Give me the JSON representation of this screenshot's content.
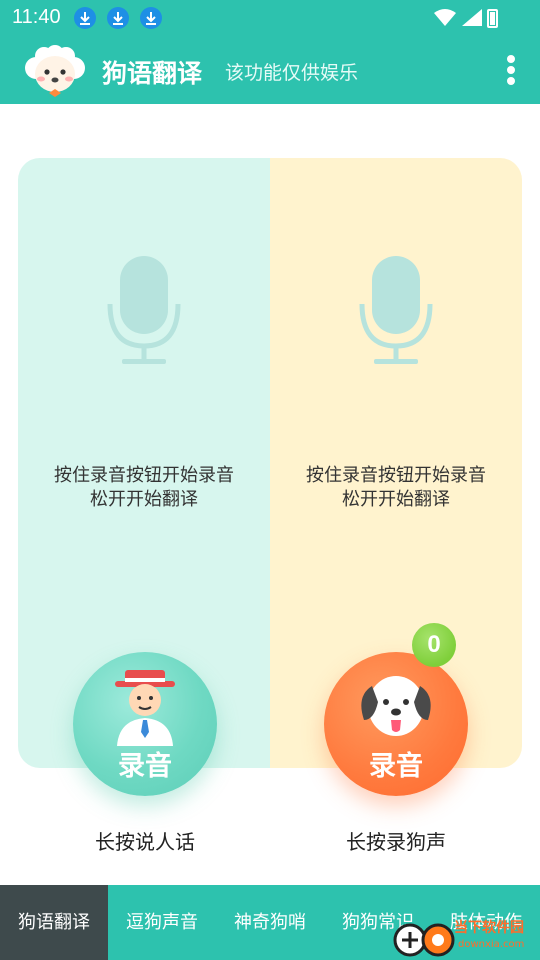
{
  "status_bar": {
    "time": "11:40"
  },
  "app_bar": {
    "title": "狗语翻译",
    "subtitle": "该功能仅供娱乐"
  },
  "panels": {
    "left": {
      "hint_line1": "按住录音按钮开始录音",
      "hint_line2": "松开开始翻译",
      "button_label": "录音",
      "caption": "长按说人话"
    },
    "right": {
      "hint_line1": "按住录音按钮开始录音",
      "hint_line2": "松开开始翻译",
      "button_label": "录音",
      "caption": "长按录狗声",
      "badge_count": "0"
    }
  },
  "tabs": [
    "狗语翻译",
    "逗狗声音",
    "神奇狗哨",
    "狗狗常识",
    "肢体动作"
  ],
  "watermark": {
    "text": "当下软件园",
    "sub": "downxia.com"
  },
  "colors": {
    "primary": "#2dc2ae",
    "active_tab": "#3e4a4c",
    "left_panel": "#d7f6ee",
    "right_panel": "#fff3ce",
    "record_orange": "#ff7a3e",
    "record_teal": "#6fd9c3",
    "badge_green": "#7fcf3a"
  }
}
